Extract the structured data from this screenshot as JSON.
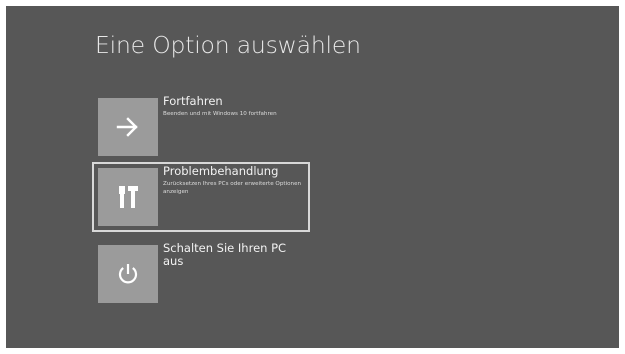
{
  "page": {
    "title": "Eine Option auswählen"
  },
  "options": [
    {
      "id": "continue",
      "label": "Fortfahren",
      "description": "Beenden und mit Windows 10 fortfahren",
      "icon": "arrow-right-icon",
      "selected": false
    },
    {
      "id": "troubleshoot",
      "label": "Problembehandlung",
      "description": "Zurücksetzen Ihres PCs oder erweiterte Optionen anzeigen",
      "icon": "tools-icon",
      "selected": true
    },
    {
      "id": "shutdown",
      "label": "Schalten Sie Ihren PC aus",
      "description": "",
      "icon": "power-icon",
      "selected": false
    }
  ],
  "colors": {
    "background": "#575757",
    "tile": "#9b9b9b",
    "text": "#f2f2f2",
    "selection_border": "#d8d8d8"
  }
}
